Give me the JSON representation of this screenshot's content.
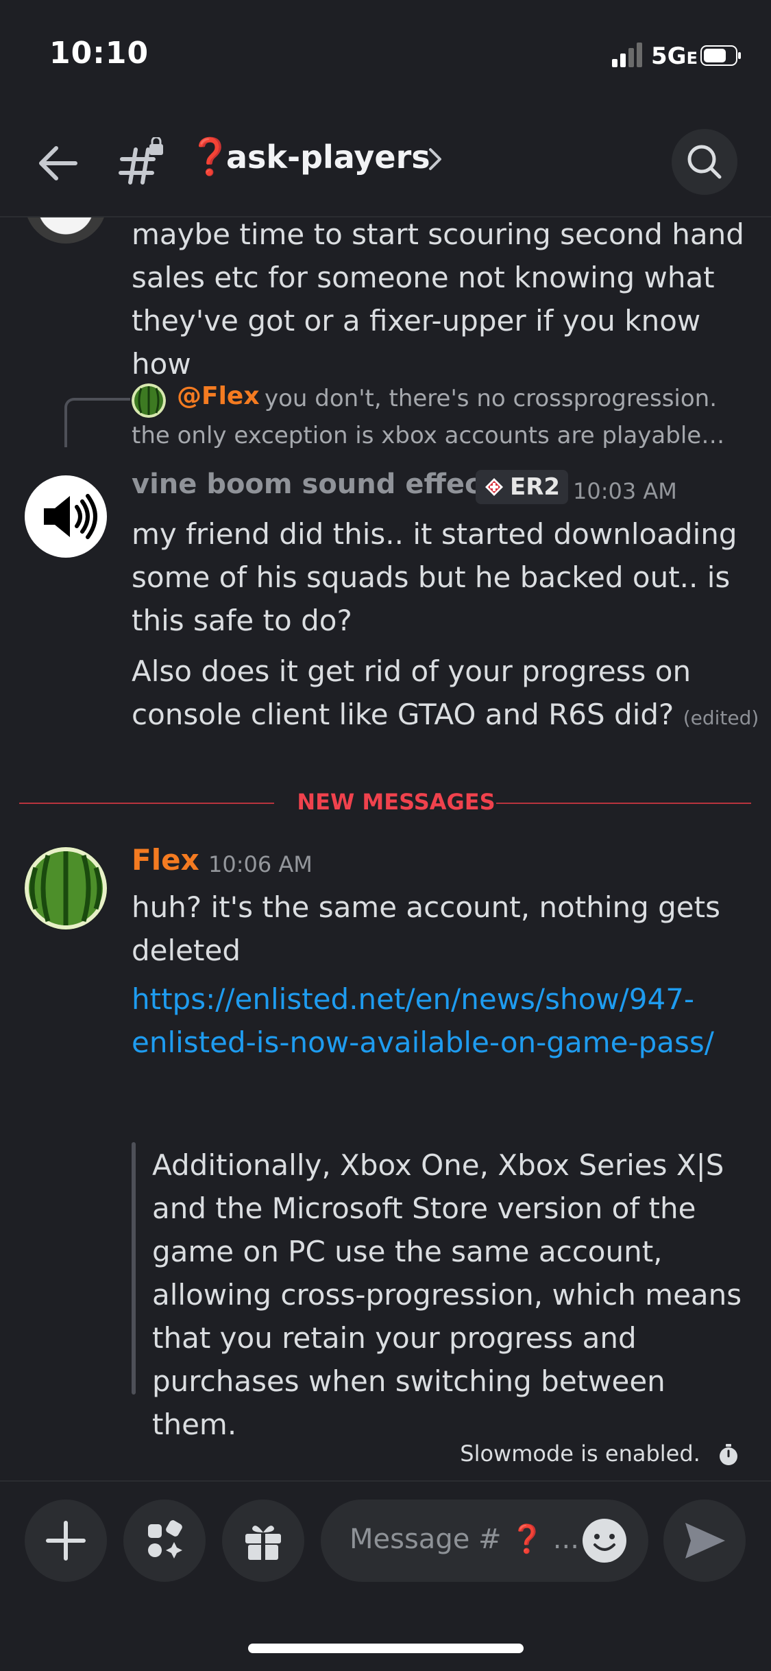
{
  "status_bar": {
    "time": "10:10",
    "network": "5G",
    "network_suffix": "E"
  },
  "header": {
    "channel_icon_glyph": "❓",
    "channel_name": "ask-players"
  },
  "messages": {
    "m1": {
      "lines": [
        "maybe time to start scouring second hand",
        "sales etc for someone not knowing what",
        "they've got or a fixer-upper if you know how"
      ]
    },
    "reply": {
      "author": "@Flex",
      "line1": "you don't, there's no crossprogression.",
      "line2": "the only exception is xbox accounts are playable…"
    },
    "m2": {
      "author": "vine boom sound effect",
      "badge": "ER2",
      "time": "10:03 AM",
      "lines": [
        "my friend did this.. it started downloading",
        "some of his squads but he backed out.. is",
        "this safe to do?"
      ],
      "lines2": [
        "Also does it get rid of your progress on",
        "console client like GTAO and R6S did?"
      ],
      "edited": "(edited)"
    },
    "new_divider": "NEW MESSAGES",
    "m3": {
      "author": "Flex",
      "time": "10:06 AM",
      "lines": [
        "huh? it's the same account, nothing gets",
        "deleted"
      ],
      "link_lines": [
        "https://enlisted.net/en/news/show/947-",
        "enlisted-is-now-available-on-game-pass/"
      ],
      "quote_lines": [
        "Additionally, Xbox One, Xbox Series X|S",
        "and the Microsoft Store version of the",
        "game on PC use the same account,",
        "allowing cross-progression, which means",
        "that you retain your progress and",
        "purchases when switching between them."
      ]
    }
  },
  "slowmode": "Slowmode is enabled.",
  "composer": {
    "placeholder_prefix": "Message # ",
    "placeholder_glyph": "❓",
    "placeholder_suffix": " ..."
  },
  "colors": {
    "accent_orange": "#f47b21",
    "link": "#1e9cf0",
    "new_messages": "#f0424d",
    "background": "#1e1f24"
  },
  "icons": [
    "back-arrow-icon",
    "hash-lock-icon",
    "chevron-right-icon",
    "search-icon",
    "speaker-icon",
    "watermelon-avatar",
    "plus-icon",
    "apps-icon",
    "gift-icon",
    "emoji-icon",
    "send-icon",
    "timer-icon"
  ]
}
